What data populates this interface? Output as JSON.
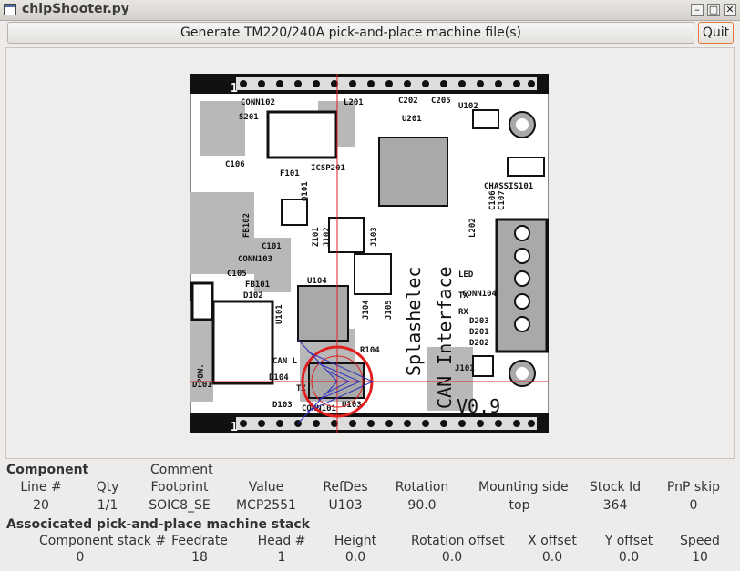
{
  "window": {
    "title": "chipShooter.py",
    "min": "–",
    "max": "□",
    "close": "✕"
  },
  "toolbar": {
    "generate_label": "Generate TM220/240A pick-and-place machine file(s)",
    "quit_label": "Quit"
  },
  "pcb": {
    "labels": {
      "conn102": "CONN102",
      "s201": "S201",
      "l201": "L201",
      "c202": "C202",
      "c205": "C205",
      "u102": "U102",
      "u201": "U201",
      "c106": "C106",
      "f101": "F101",
      "icsp201": "ICSP201",
      "q101": "Q101",
      "chassis101": "CHASSIS101",
      "c105b": "C106",
      "c107": "C107",
      "fb102": "FB102",
      "z101": "Z101",
      "j102": "J102",
      "j103": "J103",
      "l202": "L202",
      "c101": "C101",
      "conn103": "CONN103",
      "c105": "C105",
      "fb101": "FB101",
      "d102": "D102",
      "u104": "U104",
      "conn104": "CONN104",
      "led": "LED",
      "tx": "TX",
      "rx": "RX",
      "d203": "D203",
      "d201": "D201",
      "d202": "D202",
      "u101": "U101",
      "j104": "J104",
      "j105": "J105",
      "splashelec": "Splashelec",
      "can_interface": "CAN Interface",
      "r104": "R104",
      "can_l": "CAN L",
      "d104": "D104",
      "j101": "J101",
      "pow": "POW.",
      "d101": "D101",
      "tx2": "TX",
      "d103": "D103",
      "u103": "U103",
      "conn101": "CONN101",
      "v09": "V0.9",
      "pin1a": "1",
      "pin1b": "1"
    }
  },
  "component": {
    "heading": "Component",
    "comment_label": "Comment",
    "headers": [
      "Line #",
      "Qty",
      "Footprint",
      "Value",
      "RefDes",
      "Rotation",
      "Mounting side",
      "Stock Id",
      "PnP skip"
    ],
    "values": [
      "20",
      "1/1",
      "SOIC8_SE",
      "MCP2551",
      "U103",
      "90.0",
      "top",
      "364",
      "0"
    ]
  },
  "stack": {
    "heading": "Associcated pick-and-place machine stack",
    "headers": [
      "Component stack #",
      "Feedrate",
      "Head #",
      "Height",
      "Rotation offset",
      "X offset",
      "Y offset",
      "Speed"
    ],
    "values": [
      "0",
      "18",
      "1",
      "0.0",
      "0.0",
      "0.0",
      "0.0",
      "10"
    ]
  }
}
